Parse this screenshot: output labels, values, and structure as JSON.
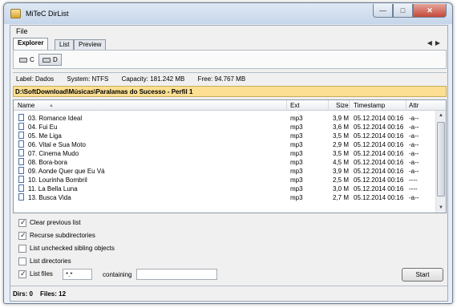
{
  "window": {
    "title": "MiTeC DirList"
  },
  "menu": {
    "file": "File"
  },
  "tabs": [
    {
      "label": "Explorer",
      "active": true
    },
    {
      "label": "List",
      "active": false
    },
    {
      "label": "Preview",
      "active": false
    }
  ],
  "drives": [
    {
      "label": "C",
      "selected": false
    },
    {
      "label": "D",
      "selected": true
    }
  ],
  "volume_info": {
    "label": "Label: Dados",
    "system": "System: NTFS",
    "capacity": "Capacity: 181.242 MB",
    "free": "Free: 94.767 MB"
  },
  "path": "D:\\SoftDownload\\Músicas\\Paralamas do Sucesso - Perfil 1",
  "list": {
    "columns": {
      "name": "Name",
      "ext": "Ext",
      "size": "Size",
      "timestamp": "Timestamp",
      "attr": "Attr"
    },
    "rows": [
      {
        "name": "03. Romance Ideal",
        "ext": "mp3",
        "size": "3,9 M",
        "timestamp": "05.12.2014 00:16",
        "attr": "-a--"
      },
      {
        "name": "04. Fui Eu",
        "ext": "mp3",
        "size": "3,6 M",
        "timestamp": "05.12.2014 00:16",
        "attr": "-a--"
      },
      {
        "name": "05. Me Liga",
        "ext": "mp3",
        "size": "3,5 M",
        "timestamp": "05.12.2014 00:16",
        "attr": "-a--"
      },
      {
        "name": "06. Vital e Sua Moto",
        "ext": "mp3",
        "size": "2,9 M",
        "timestamp": "05.12.2014 00:16",
        "attr": "-a--"
      },
      {
        "name": "07. Cinema Mudo",
        "ext": "mp3",
        "size": "3,5 M",
        "timestamp": "05.12.2014 00:16",
        "attr": "-a--"
      },
      {
        "name": "08. Bora-bora",
        "ext": "mp3",
        "size": "4,5 M",
        "timestamp": "05.12.2014 00:16",
        "attr": "-a--"
      },
      {
        "name": "09. Aonde Quer que Eu Vá",
        "ext": "mp3",
        "size": "3,9 M",
        "timestamp": "05.12.2014 00:16",
        "attr": "-a--"
      },
      {
        "name": "10. Lourinha Bombril",
        "ext": "mp3",
        "size": "2,5 M",
        "timestamp": "05.12.2014 00:16",
        "attr": "----"
      },
      {
        "name": "11. La Bella Luna",
        "ext": "mp3",
        "size": "3,0 M",
        "timestamp": "05.12.2014 00:16",
        "attr": "----"
      },
      {
        "name": "13. Busca Vida",
        "ext": "mp3",
        "size": "2,7 M",
        "timestamp": "05.12.2014 00:16",
        "attr": "-a--"
      }
    ]
  },
  "options": [
    {
      "label": "Clear previous list",
      "checked": true
    },
    {
      "label": "Recurse subdirectories",
      "checked": true
    },
    {
      "label": "List unchecked sibling objects",
      "checked": false
    },
    {
      "label": "List directories",
      "checked": false
    },
    {
      "label": "List files",
      "checked": true
    }
  ],
  "filter": {
    "mask": "*.*",
    "containing_label": "containing",
    "containing_value": ""
  },
  "start_label": "Start",
  "status": {
    "dirs": "Dirs: 0",
    "files": "Files: 12"
  }
}
